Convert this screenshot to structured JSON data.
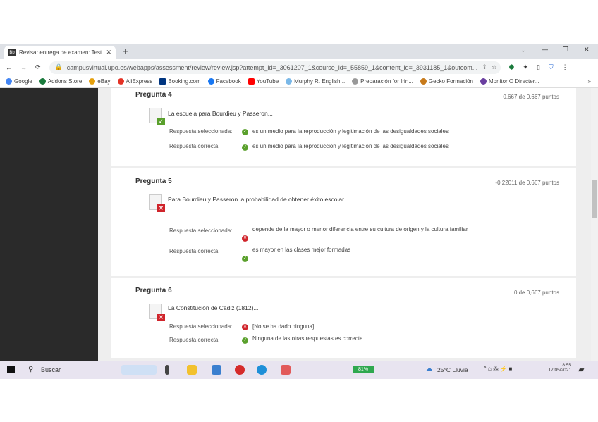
{
  "browser": {
    "tab_title": "Revisar entrega de examen: Test ...",
    "url": "campusvirtual.upo.es/webapps/assessment/review/review.jsp?attempt_id=_3061207_1&course_id=_55859_1&content_id=_3931185_1&outcom...",
    "bookmarks": [
      "Google",
      "Addons Store",
      "eBay",
      "AliExpress",
      "Booking.com",
      "Facebook",
      "YouTube",
      "Murphy R. English...",
      "Preparación for Irin...",
      "Gecko Formación",
      "Monitor O Directer..."
    ],
    "more": "»"
  },
  "colors": {
    "correct": "#5aa02c",
    "incorrect": "#d0242b"
  },
  "questions": [
    {
      "title": "Pregunta 4",
      "points": "0,667 de 0,667 puntos",
      "text": "La escuela para Bourdieu y Passeron...",
      "status": "correct",
      "selected_label": "Respuesta seleccionada:",
      "selected": "es un medio para la reproducción y legitimación de las desigualdades sociales",
      "correct_label": "Respuesta correcta:",
      "correct": "es un medio para la reproducción y legitimación de las desigualdades sociales"
    },
    {
      "title": "Pregunta 5",
      "points": "-0,22011 de 0,667 puntos",
      "text": "Para Bourdieu y Passeron la probabilidad de obtener éxito escolar ...",
      "status": "incorrect",
      "selected_label": "Respuesta seleccionada:",
      "selected": "depende de la mayor o menor diferencia entre su cultura de origen y la cultura familiar",
      "correct_label": "Respuesta correcta:",
      "correct": "es mayor en las clases mejor formadas"
    },
    {
      "title": "Pregunta 6",
      "points": "0 de 0,667 puntos",
      "text": "La Constitución de Cádiz (1812)...",
      "status": "incorrect",
      "selected_label": "Respuesta seleccionada:",
      "selected": "[No se ha dado ninguna]",
      "correct_label": "Respuesta correcta:",
      "correct": "Ninguna de las otras respuestas es correcta"
    }
  ],
  "taskbar": {
    "search": "Buscar",
    "battery": "81%",
    "weather": "25°C  Lluvia",
    "time": "18:55",
    "date": "17/05/2021"
  }
}
